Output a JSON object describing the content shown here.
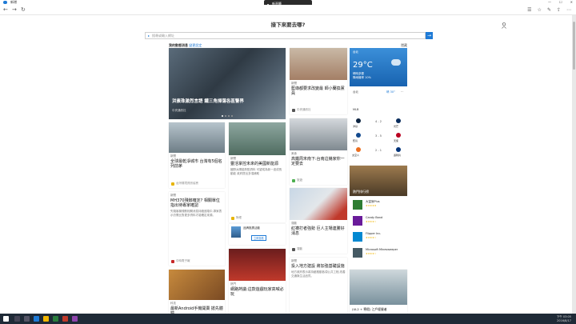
{
  "window": {
    "title": "新增",
    "tab_close": "✕"
  },
  "floatbar": {
    "label": "新頁籤"
  },
  "toolbar": {
    "back": "←",
    "forward": "→",
    "refresh": "↻"
  },
  "hero_title": "接下來要去哪?",
  "search": {
    "placeholder": "搜尋或輸入網址",
    "button": "→"
  },
  "feed": {
    "title": "我的動態消息",
    "link": "變更設定",
    "right": "隱藏"
  },
  "colors": {
    "accent": "#1e7ad6",
    "weather_bg": "#1863b0"
  },
  "cards": {
    "hero": {
      "title": "洪素珠激烈言語 鐵三角掃蕩各區警界",
      "source": "中央通訊社"
    },
    "c1": {
      "source": "新聞",
      "title": "藍綠都要求改變最 師小蘭換黨員",
      "foot": "中央通訊社"
    },
    "c2": {
      "source": "新聞",
      "title": "全球最乾淨城市 台灣有5個名列前茅",
      "foot": "台灣環境資訊協會"
    },
    "c3": {
      "source": "新聞",
      "title": "靈活掌控未來的美國新能源",
      "body": "國際太陽能熱點資料 可望成為新一波成長動能 政府提出多項補助",
      "foot": "財經"
    },
    "c4": {
      "source": "美食",
      "title": "高鐵周末南下:台南這幾家你一定要去",
      "foot": "旅遊"
    },
    "c5": {
      "source": "新聞",
      "title": "MH370殘骸確定? 相關單位指出待專家確認",
      "body": "失蹤客機殘骸相關消息持續追蹤中,專家表示仍需比對更多資料才能確定來源。",
      "foot": "中時電子報"
    },
    "c6": {
      "source": "運動",
      "title": "紅襪打者強勢 巨人主場連勝好消息",
      "foot": "運動"
    },
    "c7": {
      "source": "熱門",
      "title": "網路熱議:這款遊戲玩家高喊必玩",
      "foot": "遊戲"
    },
    "c8": {
      "source": "新聞",
      "title": "投入地方建設 將加強基礎設施",
      "body": "地方政府表示將持續推動各項公共工程,改善交通與生活品質。",
      "foot": "地方"
    },
    "c9": {
      "source": "科技",
      "title": "最新Android手機開賣 搶先體驗",
      "foot": "科技新報"
    },
    "c10": {
      "source": "旅遊",
      "title": "周末去哪玩 日月潭湖畔騎行",
      "foot": "旅遊"
    },
    "promo": {
      "label": "Video",
      "text": "影片"
    },
    "ad": {
      "title": "品牌推廣活動",
      "button": "立即查看"
    },
    "bottom": {
      "title": "(UL2 + 寒假) 江戶經營者"
    }
  },
  "weather": {
    "city": "台北",
    "temp": "29°C",
    "desc": "晴時多雲\n降雨機率 10%",
    "foot_label": "台北",
    "foot_value": "晴 30°",
    "foot_more": "…"
  },
  "sports": {
    "title": "MLB",
    "games": [
      {
        "home": "洋基",
        "away": "光芒",
        "score": "4 - 2"
      },
      {
        "home": "藍鳥",
        "away": "天使",
        "score": "3 - 5"
      },
      {
        "home": "太空人",
        "away": "遊騎兵",
        "score": "2 - 1"
      }
    ]
  },
  "feature": {
    "title": "熱門排行榜"
  },
  "apps": [
    {
      "name": "大富翁Plus",
      "stars": "★★★★★"
    },
    {
      "name": "Candy Band",
      "stars": "★★★★☆"
    },
    {
      "name": "Flipper Inc.",
      "stars": "★★★★☆"
    },
    {
      "name": "Microsoft Minesweeper",
      "stars": "★★★★☆"
    }
  ],
  "taskbar": {
    "time": "下午 03:05",
    "date": "2016/8/17"
  }
}
